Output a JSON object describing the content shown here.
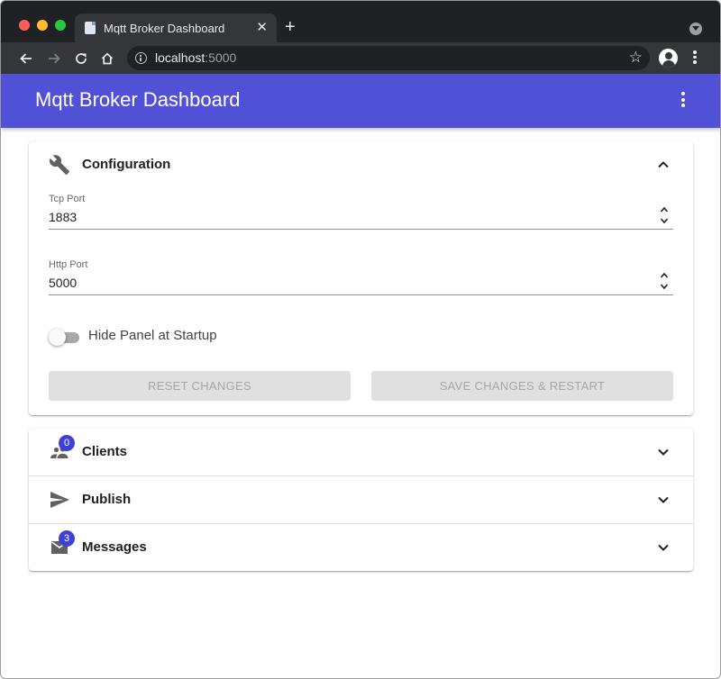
{
  "browser": {
    "tab_title": "Mqtt Broker Dashboard",
    "tab_close": "✕",
    "new_tab": "+",
    "url_host": "localhost",
    "url_port": ":5000",
    "star": "☆"
  },
  "app": {
    "title": "Mqtt Broker Dashboard",
    "accent_color": "#5151d8",
    "badge_color": "#4040d6"
  },
  "configuration": {
    "title": "Configuration",
    "icon": "wrench-icon",
    "expanded": true,
    "tcp_port": {
      "label": "Tcp Port",
      "value": "1883"
    },
    "http_port": {
      "label": "Http Port",
      "value": "5000"
    },
    "hide_panel": {
      "label": "Hide Panel at Startup",
      "checked": false
    },
    "reset_label": "RESET CHANGES",
    "save_label": "SAVE CHANGES & RESTART"
  },
  "panels": {
    "clients": {
      "title": "Clients",
      "icon": "people-icon",
      "badge": "0"
    },
    "publish": {
      "title": "Publish",
      "icon": "send-icon"
    },
    "messages": {
      "title": "Messages",
      "icon": "mail-icon",
      "badge": "3"
    }
  }
}
